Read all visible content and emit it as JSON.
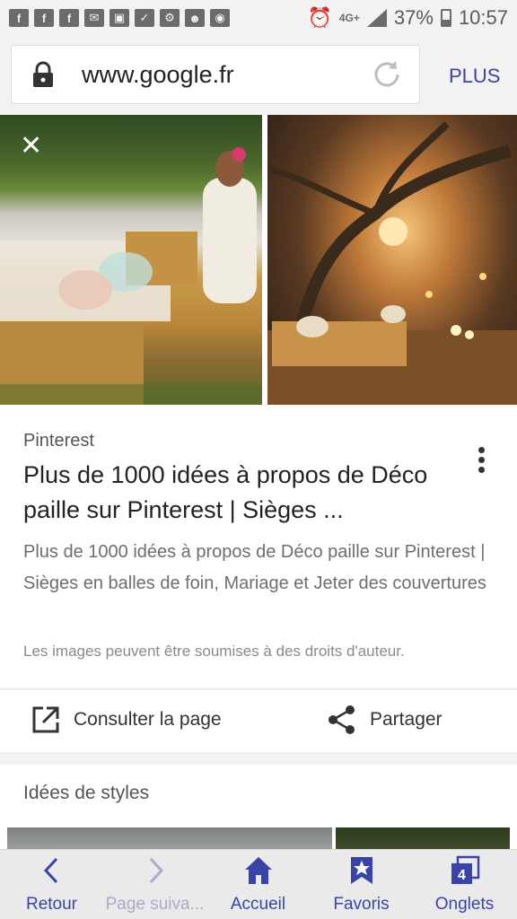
{
  "status_bar": {
    "left_icons": [
      "facebook-icon",
      "facebook-icon",
      "facebook-icon",
      "mail-icon",
      "image-icon",
      "check-icon",
      "bike-icon",
      "android-icon",
      "camera-icon"
    ],
    "network": "4G+",
    "battery": "37%",
    "time": "10:57"
  },
  "url_bar": {
    "url": "www.google.fr",
    "plus_label": "PLUS"
  },
  "result": {
    "source": "Pinterest",
    "title": "Plus de 1000 idées à propos de Déco paille sur Pinterest | Sièges ...",
    "description": "Plus de 1000 idées à propos de Déco paille sur Pinterest | Sièges en balles de foin, Mariage et Jeter des couvertures",
    "copyright_note": "Les images peuvent être soumises à des droits d'auteur."
  },
  "actions": {
    "visit_label": "Consulter la page",
    "share_label": "Partager"
  },
  "styles": {
    "title": "Idées de styles"
  },
  "bottom_nav": {
    "back": "Retour",
    "next": "Page suiva...",
    "home": "Accueil",
    "favorites": "Favoris",
    "tabs": "Onglets",
    "tab_count": "4"
  },
  "colors": {
    "accent": "#3a44a8"
  }
}
